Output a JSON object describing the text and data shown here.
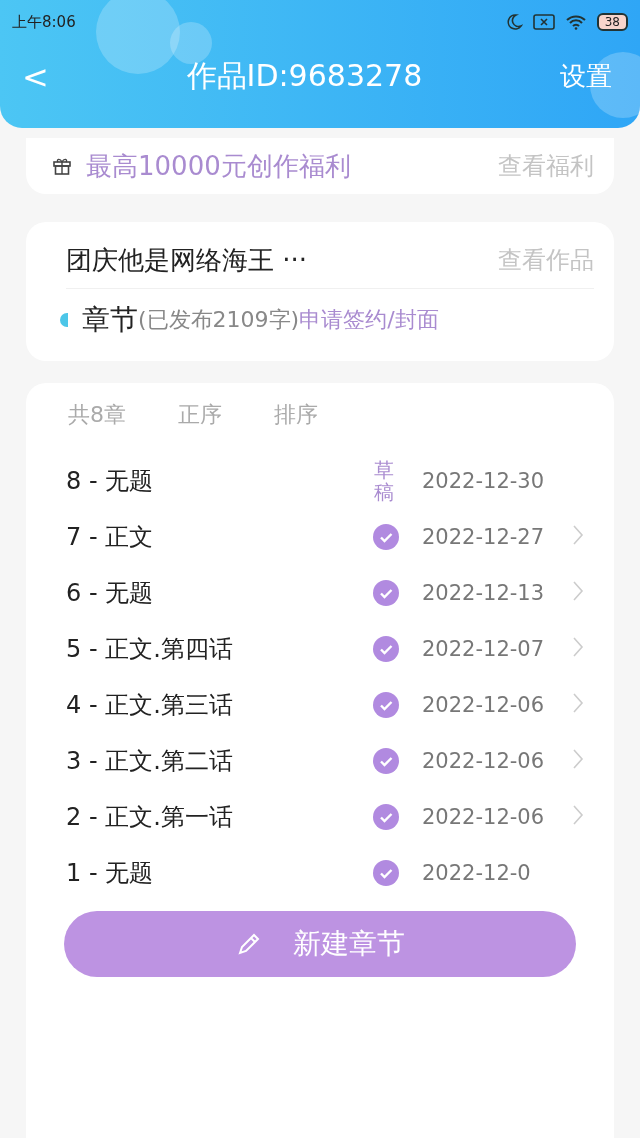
{
  "status_bar": {
    "time": "上午8:06",
    "battery": "38"
  },
  "header": {
    "back": "<",
    "title": "作品ID:9683278",
    "settings": "设置"
  },
  "benefit": {
    "text": "最高10000元创作福利",
    "link": "查看福利"
  },
  "work": {
    "title": "团庆他是网络海王 ···",
    "link": "查看作品",
    "section": "章节",
    "published": "(已发布2109字)",
    "apply": "申请签约/封面"
  },
  "chapters": {
    "count": "共8章",
    "order": "正序",
    "sort": "排序",
    "rows": [
      {
        "title": "8 - 无题",
        "draft": true,
        "status_label": "草稿",
        "date": "2022-12-30",
        "arrow": false
      },
      {
        "title": "7 - 正文",
        "draft": false,
        "date": "2022-12-27",
        "arrow": true
      },
      {
        "title": "6 - 无题",
        "draft": false,
        "date": "2022-12-13",
        "arrow": true
      },
      {
        "title": "5 - 正文.第四话",
        "draft": false,
        "date": "2022-12-07",
        "arrow": true
      },
      {
        "title": "4 - 正文.第三话",
        "draft": false,
        "date": "2022-12-06",
        "arrow": true
      },
      {
        "title": "3 - 正文.第二话",
        "draft": false,
        "date": "2022-12-06",
        "arrow": true
      },
      {
        "title": "2 - 正文.第一话",
        "draft": false,
        "date": "2022-12-06",
        "arrow": true
      },
      {
        "title": "1 - 无题",
        "draft": false,
        "date": "2022-12-0",
        "arrow": false
      }
    ]
  },
  "new_chapter": "新建章节"
}
